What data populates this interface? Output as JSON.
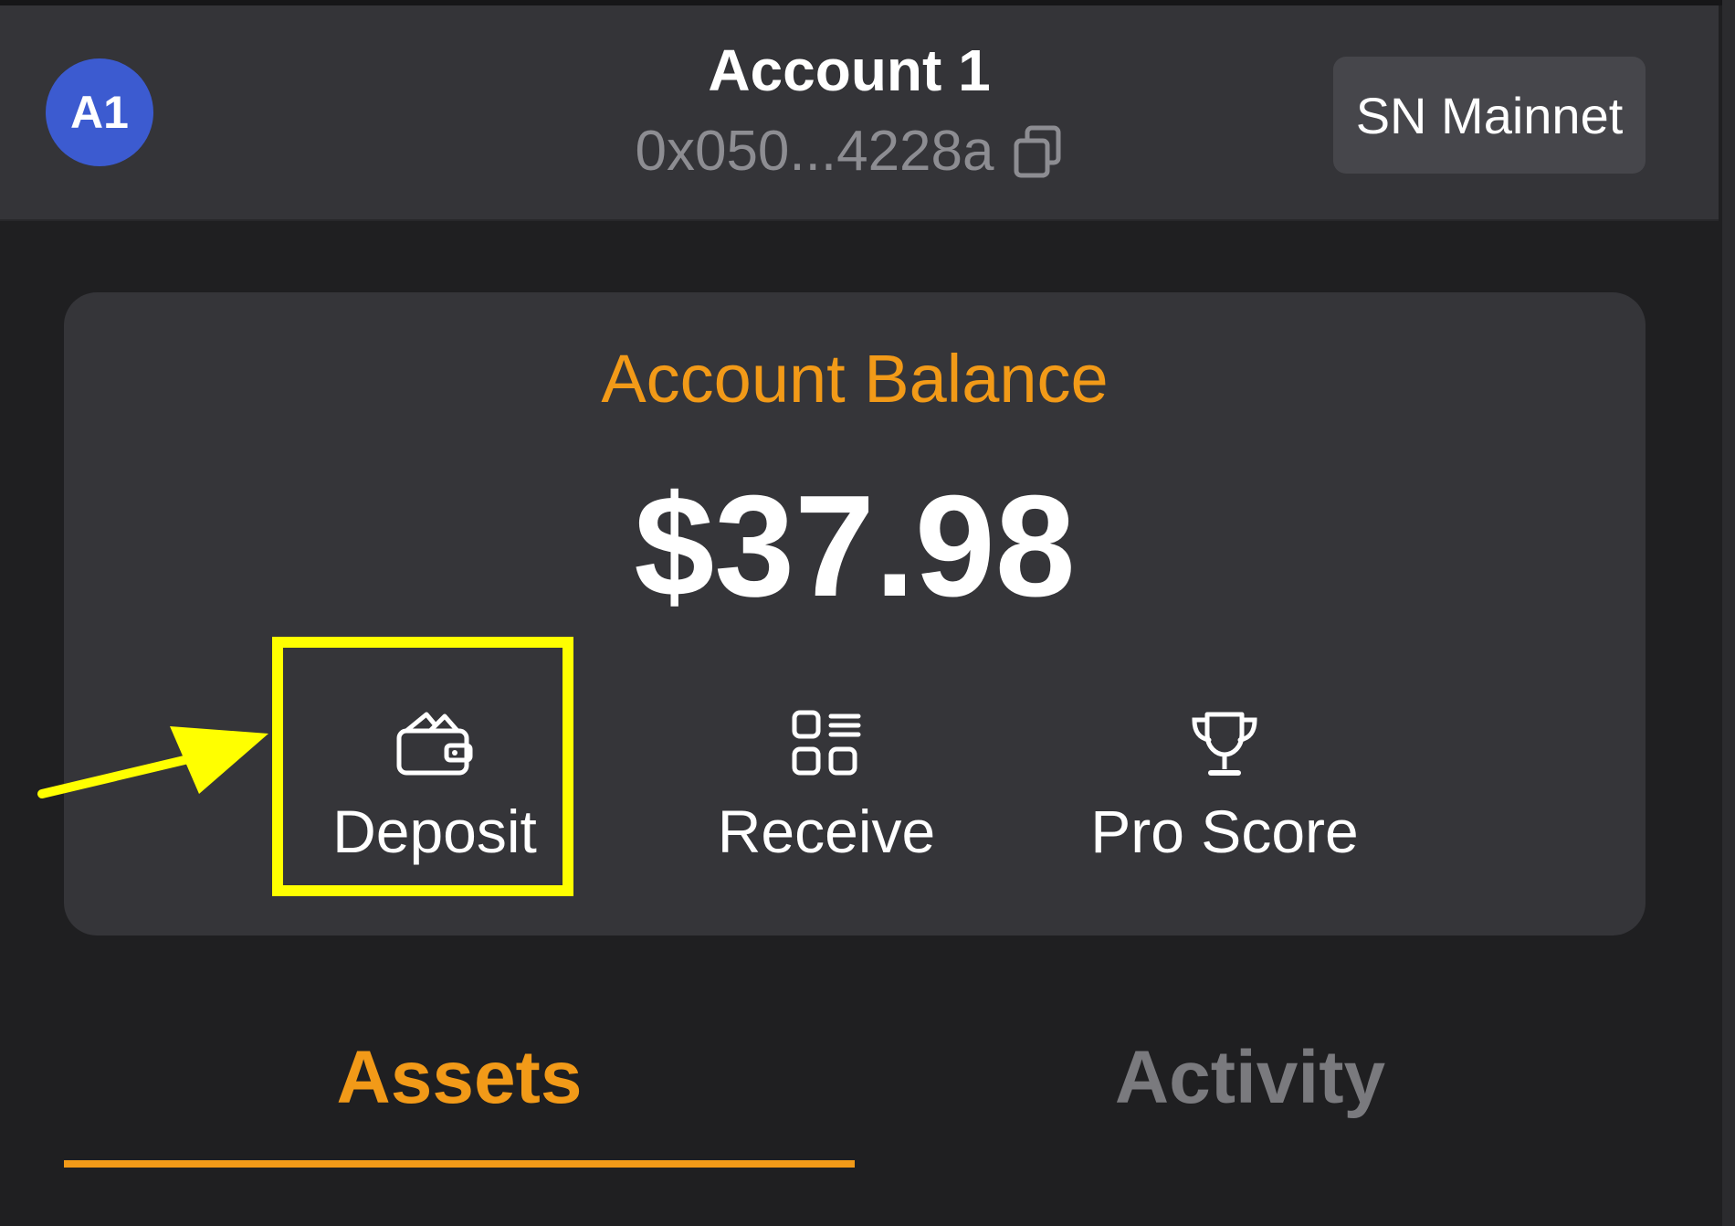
{
  "header": {
    "avatar_text": "A1",
    "account_name": "Account 1",
    "address": "0x050...4228a",
    "network": "SN Mainnet"
  },
  "balance": {
    "label": "Account Balance",
    "value": "$37.98"
  },
  "actions": [
    {
      "label": "Deposit",
      "icon": "wallet-icon"
    },
    {
      "label": "Receive",
      "icon": "qr-grid-icon"
    },
    {
      "label": "Pro Score",
      "icon": "trophy-icon"
    }
  ],
  "tabs": [
    {
      "label": "Assets",
      "active": true
    },
    {
      "label": "Activity",
      "active": false
    }
  ],
  "colors": {
    "accent": "#f29a18",
    "avatar": "#3c5bd0",
    "highlight": "#ffff00",
    "background": "#1f1f21",
    "card": "#353539"
  },
  "annotation": {
    "highlighted_element": "Deposit",
    "arrow_color": "#ffff00"
  }
}
